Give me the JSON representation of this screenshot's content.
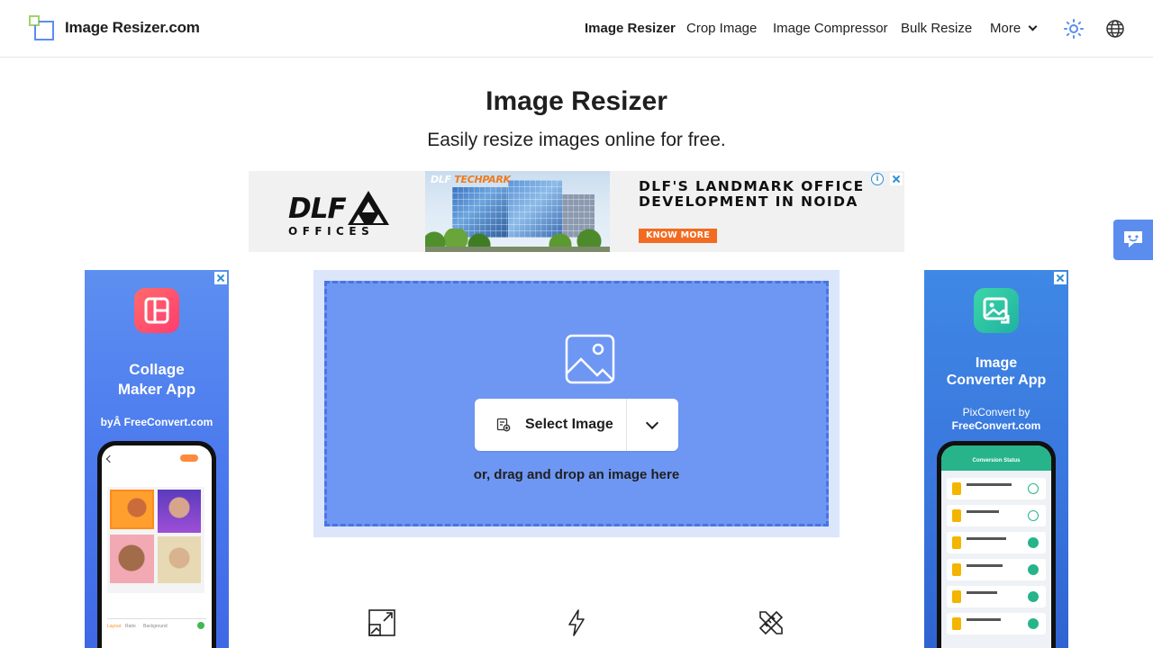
{
  "header": {
    "logo_text": "Image Resizer.com",
    "nav": [
      {
        "label": "Image Resizer",
        "active": true
      },
      {
        "label": "Crop Image"
      },
      {
        "label": "Image Compressor"
      },
      {
        "label": "Bulk Resize"
      },
      {
        "label": "More"
      }
    ],
    "icons": [
      "sun-icon",
      "globe-icon"
    ],
    "accent_color": "#5b8def"
  },
  "hero": {
    "title": "Image Resizer",
    "subtitle": "Easily resize images online for free."
  },
  "top_ad": {
    "brand": "DLF",
    "brand_sub": "OFFICES",
    "photo_caption_1": "DLF",
    "photo_caption_2": "TECHPARK",
    "headline": "DLF'S LANDMARK OFFICE DEVELOPMENT IN NOIDA",
    "cta": "KNOW MORE"
  },
  "left_ad": {
    "title_line1": "Collage",
    "title_line2": "Maker App",
    "byline": "byÂ FreeConvert.com"
  },
  "right_ad": {
    "title_line1": "Image",
    "title_line2": "Converter App",
    "byline_line1": "PixConvert by",
    "byline_line2": "FreeConvert.com",
    "phone_header": "Conversion Status"
  },
  "upload": {
    "button_label": "Select Image",
    "drag_text": "or, drag and drop an image here",
    "zone_color": "#6e97f3"
  },
  "features": {
    "icons": [
      "resize-icon",
      "lightning-icon",
      "tools-icon"
    ]
  }
}
